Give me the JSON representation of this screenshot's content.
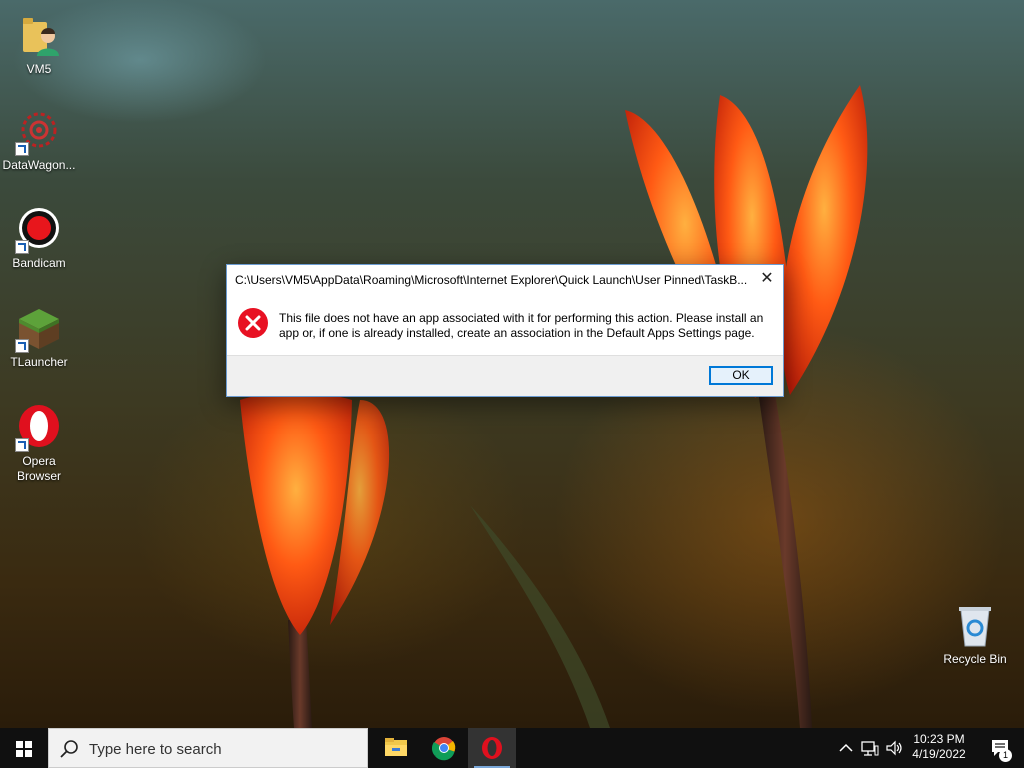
{
  "desktop": {
    "icons": [
      {
        "label": "VM5"
      },
      {
        "label": "DataWagon..."
      },
      {
        "label": "Bandicam"
      },
      {
        "label": "TLauncher"
      },
      {
        "label": "Opera Browser"
      },
      {
        "label": "Recycle Bin"
      }
    ]
  },
  "dialog": {
    "title": "C:\\Users\\VM5\\AppData\\Roaming\\Microsoft\\Internet Explorer\\Quick Launch\\User Pinned\\TaskB...",
    "message": "This file does not have an app associated with it for performing this action. Please install an app or, if one is already installed, create an association in the Default Apps Settings page.",
    "ok_label": "OK",
    "close_glyph": "✕"
  },
  "taskbar": {
    "search_placeholder": "Type here to search",
    "apps": [
      "file-explorer",
      "chrome",
      "opera"
    ],
    "clock_time": "10:23 PM",
    "clock_date": "4/19/2022",
    "notification_count": "1"
  },
  "colors": {
    "accent": "#0078d7",
    "error_red": "#e81123",
    "taskbar": "#101010"
  }
}
